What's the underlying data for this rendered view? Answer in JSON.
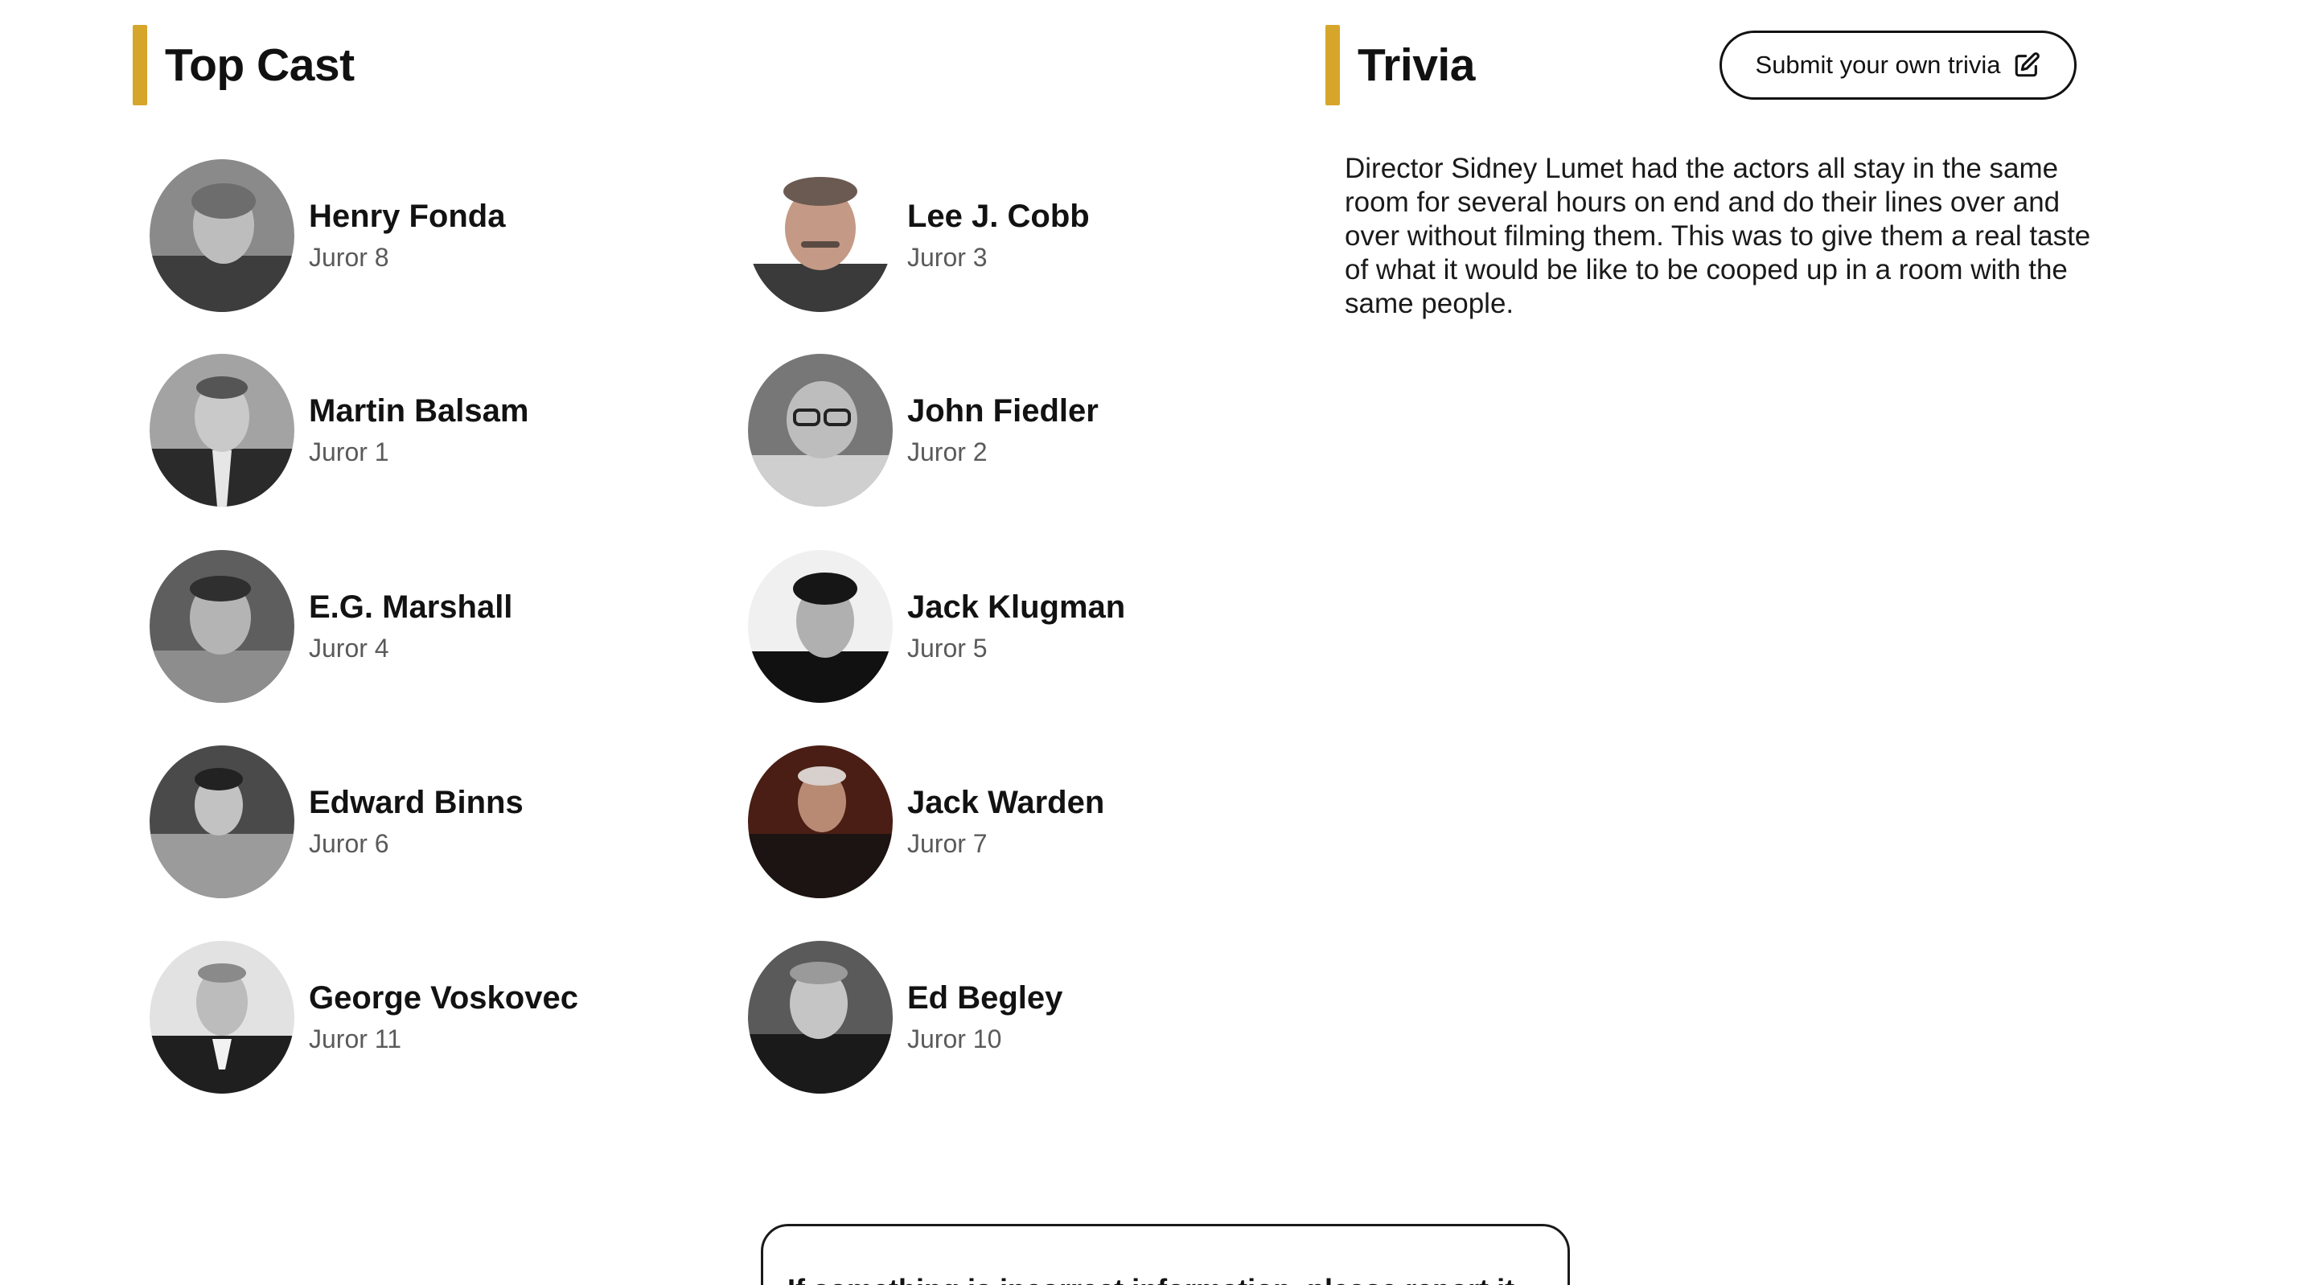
{
  "top_cast": {
    "title": "Top Cast",
    "members": [
      {
        "name": "Henry Fonda",
        "character": "Juror 8"
      },
      {
        "name": "Lee J. Cobb",
        "character": "Juror 3"
      },
      {
        "name": "Martin Balsam",
        "character": "Juror 1"
      },
      {
        "name": "John Fiedler",
        "character": "Juror 2"
      },
      {
        "name": "E.G. Marshall",
        "character": "Juror 4"
      },
      {
        "name": "Jack Klugman",
        "character": "Juror 5"
      },
      {
        "name": "Edward Binns",
        "character": "Juror 6"
      },
      {
        "name": "Jack Warden",
        "character": "Juror 7"
      },
      {
        "name": "George Voskovec",
        "character": "Juror 11"
      },
      {
        "name": "Ed Begley",
        "character": "Juror 10"
      }
    ]
  },
  "trivia": {
    "title": "Trivia",
    "submit_label": "Submit your own trivia",
    "submit_icon": "edit-icon",
    "text": "Director Sidney Lumet had the actors all stay in the same room for several hours on end and do their lines over and over without filming them. This was to give them a real taste of what it would be like to be cooped up in a room with the same people."
  },
  "bottom_card": {
    "text": "If something is incorrect information, please report it"
  },
  "colors": {
    "accent": "#d5a629",
    "text": "#121212",
    "secondary_text": "#5a5a5a",
    "background": "#ffffff"
  }
}
